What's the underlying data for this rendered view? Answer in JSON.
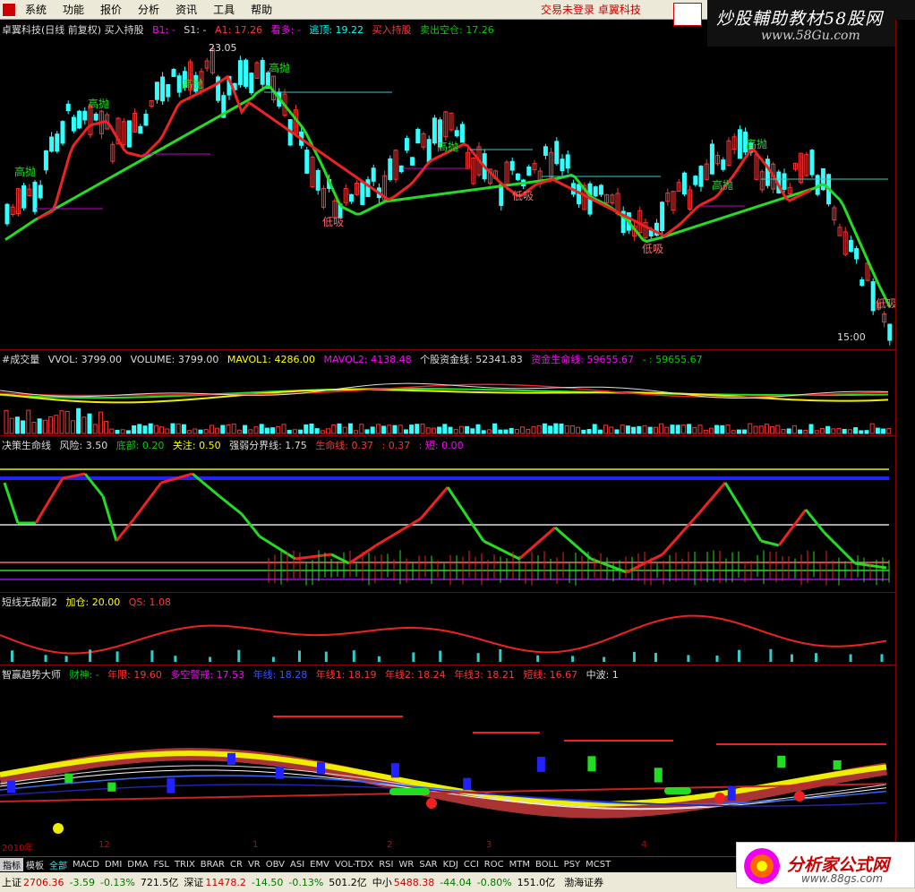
{
  "menu": {
    "items": [
      "系统",
      "功能",
      "报价",
      "分析",
      "资讯",
      "工具",
      "帮助"
    ],
    "login_status": "交易未登录  卓翼科技"
  },
  "banner": {
    "title": "炒股輔助教材58股网",
    "url": "www.58Gu.com"
  },
  "main_chart": {
    "title": "卓翼科技(日线 前复权) 买入持股",
    "b1": "B1: -",
    "s1": "S1: -",
    "a1": "A1: 17.26",
    "watch": "看多: -",
    "escape": "逃顶: 19.22",
    "buy_hold": "买入持股",
    "sell": "卖出空仓: 17.26",
    "high_price": "23.05",
    "time_label": "15:00",
    "labels": {
      "high": "高抛",
      "low": "低吸"
    }
  },
  "vol_panel": {
    "title": "#成交量",
    "vvol": "VVOL: 3799.00",
    "volume": "VOLUME: 3799.00",
    "mavol1": "MAVOL1: 4286.00",
    "mavol2": "MAVOL2: 4138.48",
    "fund": "个股资金线: 52341.83",
    "lifeline": "资金生命线: 59655.67",
    "extra": "- : 59655.67"
  },
  "life_panel": {
    "title": "决策生命线",
    "risk": "风险: 3.50",
    "bottom": "底部: 0.20",
    "attention": "关注: 0.50",
    "strength": "强弱分界线: 1.75",
    "life": "生命线: 0.37",
    "val": ": 0.37",
    "short": ": 短: 0.00"
  },
  "short_panel": {
    "title": "短线无敌副2",
    "add": "加仓: 20.00",
    "qs": "QS: 1.08"
  },
  "trend_panel": {
    "title": "智赢趋势大师",
    "caishen": "财神: -",
    "niandiu": "年限: 19.60",
    "duokong": "多空警戒: 17.53",
    "n1": "年线: 18.28",
    "n2": "年线1: 18.19",
    "n3": "年线2: 18.24",
    "n4": "年线3: 18.21",
    "short": "短线: 16.67",
    "mid": "中波: 1"
  },
  "date_axis": {
    "year": "2010年",
    "months": [
      "12",
      "1",
      "2",
      "3",
      "4"
    ]
  },
  "tabs": [
    "指标",
    "模板",
    "全部",
    "MACD",
    "DMI",
    "DMA",
    "FSL",
    "TRIX",
    "BRAR",
    "CR",
    "VR",
    "OBV",
    "ASI",
    "EMV",
    "VOL-TDX",
    "RSI",
    "WR",
    "SAR",
    "KDJ",
    "CCI",
    "ROC",
    "MTM",
    "BOLL",
    "PSY",
    "MCST"
  ],
  "status": {
    "sh_label": "上证",
    "sh_val": "2706.36",
    "sh_chg": "-3.59",
    "sh_pct": "-0.13%",
    "sh_amt": "721.5亿",
    "sz_label": "深证",
    "sz_val": "11478.2",
    "sz_chg": "-14.50",
    "sz_pct": "-0.13%",
    "sz_amt": "501.2亿",
    "zx_label": "中小",
    "zx_val": "5488.38",
    "zx_chg": "-44.04",
    "zx_pct": "-0.80%",
    "zx_amt": "151.0亿",
    "broker": "渤海证券"
  },
  "footer_logo": {
    "title": "分析家公式网",
    "url": "www.88gs.com"
  }
}
